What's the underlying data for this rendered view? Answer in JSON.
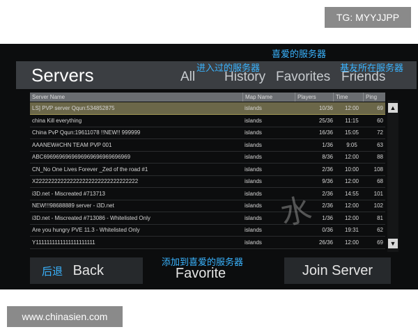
{
  "overlay": {
    "tg_label": "TG: MYYJJPP",
    "site_label": "www.chinasien.com"
  },
  "header": {
    "title": "Servers"
  },
  "tabs": [
    {
      "label": "All"
    },
    {
      "label": "History"
    },
    {
      "label": "Favorites"
    },
    {
      "label": "Friends"
    }
  ],
  "annotations": {
    "favorites_servers": "喜爱的服务器",
    "history_servers": "进入过的服务器",
    "friends_servers": "基友所在服务器",
    "add_favorite": "添加到喜爱的服务器",
    "back_cn": "后退"
  },
  "table": {
    "columns": [
      "Server Name",
      "Map Name",
      "Players",
      "Time",
      "Ping"
    ],
    "rows": [
      {
        "name": "LS] PVP server Qqun:534852875",
        "map": "islands",
        "players": "10/36",
        "time": "12:00",
        "ping": "69"
      },
      {
        "name": "china Kill everything",
        "map": "islands",
        "players": "25/36",
        "time": "11:15",
        "ping": "60"
      },
      {
        "name": "China PvP Qqun:19611078 !!NEW!! 999999",
        "map": "islands",
        "players": "16/36",
        "time": "15:05",
        "ping": "72"
      },
      {
        "name": "AAANEW#CHN TEAM PVP 001",
        "map": "islands",
        "players": "1/36",
        "time": "9:05",
        "ping": "63"
      },
      {
        "name": "ABC6969696969696969696969696969",
        "map": "islands",
        "players": "8/36",
        "time": "12:00",
        "ping": "88"
      },
      {
        "name": "CN_No One Lives Forever _Zed of the road #1",
        "map": "islands",
        "players": "2/36",
        "time": "10:00",
        "ping": "108"
      },
      {
        "name": "X222222222222222222222222222222222",
        "map": "islands",
        "players": "9/36",
        "time": "12:00",
        "ping": "68"
      },
      {
        "name": "i3D.net - Miscreated #713713",
        "map": "islands",
        "players": "2/36",
        "time": "14:55",
        "ping": "101"
      },
      {
        "name": "NEW!!!98688889 server  - i3D.net",
        "map": "islands",
        "players": "2/36",
        "time": "12:00",
        "ping": "102"
      },
      {
        "name": "i3D.net - Miscreated #713086 - Whitelisted Only",
        "map": "islands",
        "players": "1/36",
        "time": "12:00",
        "ping": "81"
      },
      {
        "name": "Are you hungry PVE 11.3 - Whitelisted Only",
        "map": "islands",
        "players": "0/36",
        "time": "19:31",
        "ping": "62"
      },
      {
        "name": "Y1111111111111111111111",
        "map": "islands",
        "players": "26/36",
        "time": "12:00",
        "ping": "69"
      }
    ]
  },
  "buttons": {
    "back": "Back",
    "favorite": "Favorite",
    "join": "Join Server"
  },
  "scroll": {
    "up": "▲",
    "down": "▼"
  },
  "colors": {
    "annotation": "#3ab4ff",
    "selected_row": "#6b6749"
  }
}
